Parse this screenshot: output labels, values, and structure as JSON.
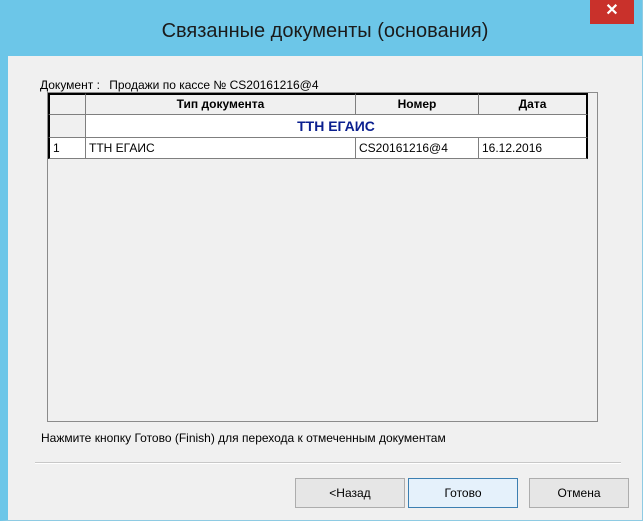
{
  "window": {
    "title": "Связанные документы (основания)",
    "close_label": "✕"
  },
  "document": {
    "label": "Документ :",
    "value": "Продажи по кассе № CS20161216@4"
  },
  "table": {
    "columns": [
      "Тип документа",
      "Номер",
      "Дата"
    ],
    "group_title": "ТТН ЕГАИС",
    "rows": [
      {
        "num": "1",
        "type": "ТТН ЕГАИС",
        "number": "CS20161216@4",
        "date": "16.12.2016"
      }
    ]
  },
  "hint": "Нажмите кнопку Готово (Finish) для перехода к отмеченным документам",
  "buttons": {
    "back": "<Назад",
    "finish": "Готово",
    "cancel": "Отмена"
  }
}
